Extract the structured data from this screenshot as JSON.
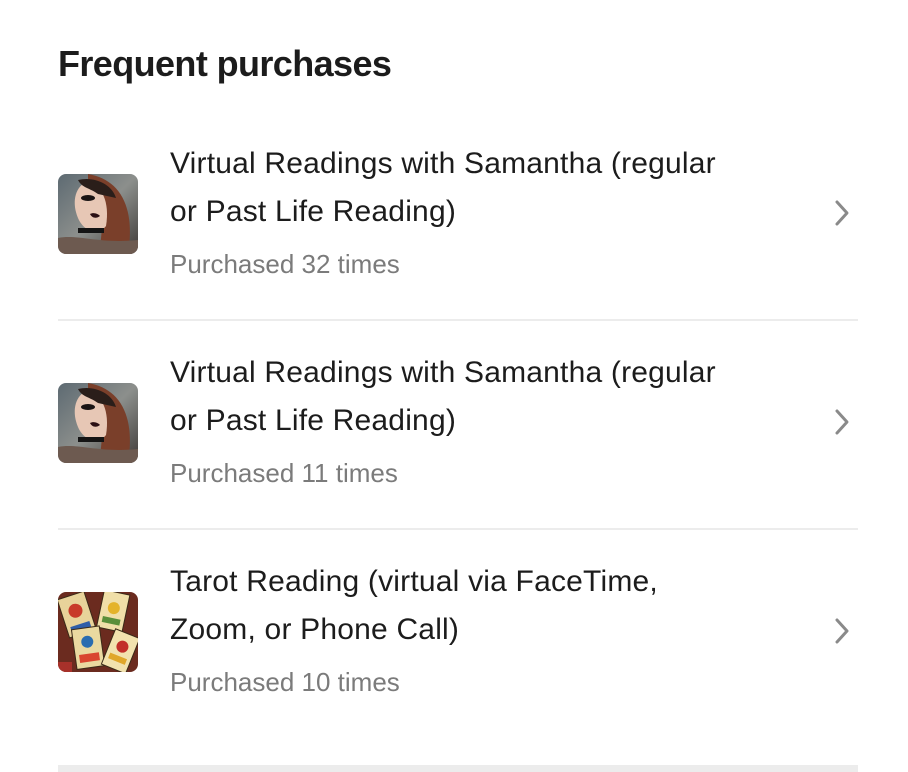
{
  "section": {
    "title": "Frequent purchases"
  },
  "items": [
    {
      "title_line1": "Virtual Readings with Samantha (regular",
      "title_line2": "or Past Life Reading)",
      "subtitle": "Purchased 32 times",
      "thumbnail": "portrait-photo",
      "chevron": "chevron-right-icon"
    },
    {
      "title_line1": "Virtual Readings with Samantha (regular",
      "title_line2": "or Past Life Reading)",
      "subtitle": "Purchased 11 times",
      "thumbnail": "portrait-photo",
      "chevron": "chevron-right-icon"
    },
    {
      "title_line1": "Tarot Reading (virtual via FaceTime,",
      "title_line2": "Zoom, or Phone Call)",
      "subtitle": "Purchased 10 times",
      "thumbnail": "tarot-cards-photo",
      "chevron": "chevron-right-icon"
    }
  ],
  "colors": {
    "title": "#1c1c1c",
    "subtitle": "#7b7b7b",
    "divider": "#ececec",
    "chevron": "#8a8a8a"
  }
}
